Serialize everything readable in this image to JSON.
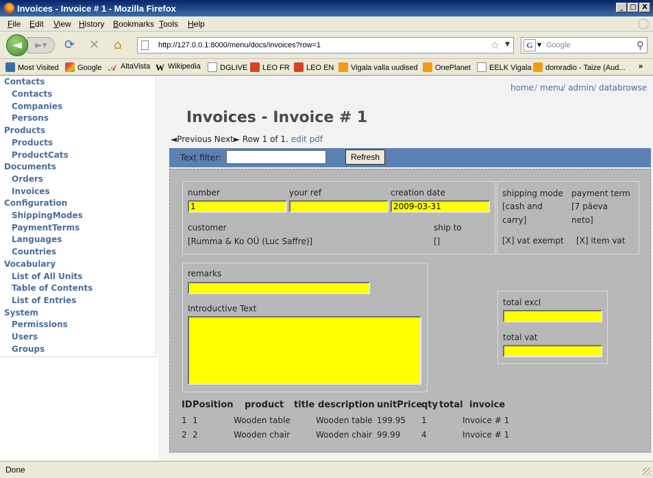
{
  "window": {
    "title": "Invoices - Invoice # 1 - Mozilla Firefox",
    "controls": [
      "_",
      "□",
      "X"
    ]
  },
  "menu": [
    "File",
    "Edit",
    "View",
    "History",
    "Bookmarks",
    "Tools",
    "Help"
  ],
  "navbar": {
    "url": "http://127.0.0.1:8000/menu/docs/invoices?row=1",
    "search_placeholder": "Google"
  },
  "bookmarks": [
    "Most Visited",
    "Google",
    "AltaVista",
    "Wikipedia",
    "DGLIVE",
    "LEO FR",
    "LEO EN",
    "Vigala valla uudised",
    "OnePlanet",
    "EELK Vigala",
    "domradio - Taize (Aud...",
    "»"
  ],
  "sidebar": {
    "groups": [
      {
        "label": "Contacts",
        "items": [
          "Contacts",
          "Companies",
          "Persons"
        ]
      },
      {
        "label": "Products",
        "items": [
          "Products",
          "ProductCats"
        ]
      },
      {
        "label": "Documents",
        "items": [
          "Orders",
          "Invoices"
        ]
      },
      {
        "label": "Configuration",
        "items": [
          "ShippingModes",
          "PaymentTerms",
          "Languages",
          "Countries"
        ]
      },
      {
        "label": "Vocabulary",
        "items": [
          "List of All Units",
          "Table of Contents",
          "List of Entries"
        ]
      },
      {
        "label": "System",
        "items": [
          "Permissions",
          "Users",
          "Groups"
        ]
      }
    ]
  },
  "breadcrumb": [
    "home",
    "menu",
    "admin",
    "databrowse"
  ],
  "page_title": "Invoices - Invoice # 1",
  "recnav": {
    "previous": "◄Previous",
    "next": "Next►",
    "row_info": "Row 1 of 1.",
    "edit": "edit",
    "pdf": "pdf"
  },
  "filter": {
    "label": "Text filter:",
    "value": "",
    "refresh": "Refresh"
  },
  "form": {
    "number_label": "number",
    "number_value": "1",
    "yourref_label": "your ref",
    "yourref_value": "",
    "creation_date_label": "creation date",
    "creation_date_value": "2009-03-31",
    "customer_label": "customer",
    "customer_value": "[Rumma & Ko OÜ (Luc Saffre)]",
    "shipto_label": "ship to",
    "shipto_value": "[]",
    "shipping_mode_label": "shipping mode",
    "shipping_mode_line1": "[cash and",
    "shipping_mode_line2": "carry]",
    "payment_term_label": "payment term",
    "payment_term_line1": "[7 päeva",
    "payment_term_line2": "neto]",
    "vat_exempt": "[X] vat exempt",
    "item_vat": "[X] item vat",
    "remarks_label": "remarks",
    "remarks_value": "",
    "intro_label": "Introductive Text",
    "intro_value": "",
    "total_excl_label": "total excl",
    "total_excl_value": "",
    "total_vat_label": "total vat",
    "total_vat_value": ""
  },
  "items_table": {
    "headers": [
      "ID",
      "Position",
      "product",
      "title",
      "description",
      "unitPrice",
      "qty",
      "total",
      "invoice"
    ],
    "rows": [
      [
        "1",
        "1",
        "Wooden table",
        "",
        "Wooden table",
        "199.95",
        "1",
        "",
        "Invoice # 1"
      ],
      [
        "2",
        "2",
        "Wooden chair",
        "",
        "Wooden chair",
        "99.99",
        "4",
        "",
        "Invoice # 1"
      ]
    ]
  },
  "status": "Done",
  "colors": {
    "titlebar": "#0a246a",
    "link": "#4b6d9b",
    "filterbar": "#5b80b2",
    "field": "#ffff00",
    "form_bg": "#b8b8b8"
  }
}
